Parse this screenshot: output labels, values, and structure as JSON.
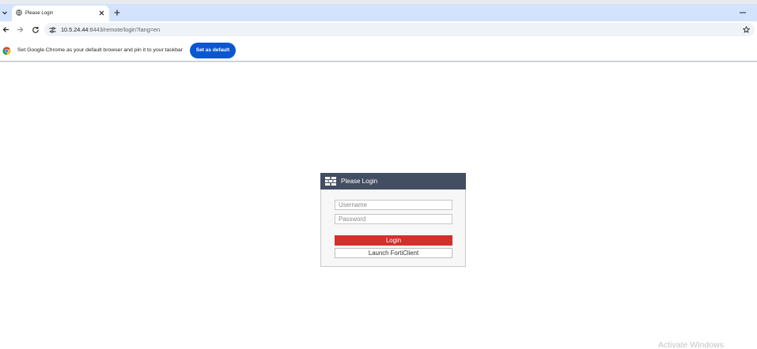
{
  "theme": {
    "tab-strip": "#d3e3fd",
    "omnibox": "#eff2f7",
    "chrome-blue": "#0b57d0",
    "login-header": "#434e63",
    "login-red": "#d0312d"
  },
  "browser": {
    "tab_search_icon": "chevron-down-icon",
    "tab": {
      "favicon_icon": "globe-icon",
      "title": "Please Login",
      "close_icon": "close-icon"
    },
    "new_tab_icon": "plus-icon",
    "minimize_icon": "minimize-icon",
    "toolbar": {
      "back_icon": "back-arrow-icon",
      "forward_icon": "forward-arrow-icon",
      "reload_icon": "reload-icon"
    },
    "omnibox": {
      "site_info_icon": "tune-icon",
      "url_host": "10.5.24.44",
      "url_rest": ":8443/remote/login?lang=en",
      "bookmark_icon": "star-icon"
    }
  },
  "infobar": {
    "icon": "chrome-logo-icon",
    "message": "Set Google Chrome as your default browser and pin it to your taskbar",
    "button_label": "Set as default"
  },
  "login": {
    "logo_icon": "fortinet-logo-icon",
    "title": "Please Login",
    "username_placeholder": "Username",
    "password_placeholder": "Password",
    "login_button_label": "Login",
    "forticlient_button_label": "Launch FortiClient"
  },
  "watermark": {
    "text": "Activate Windows"
  }
}
